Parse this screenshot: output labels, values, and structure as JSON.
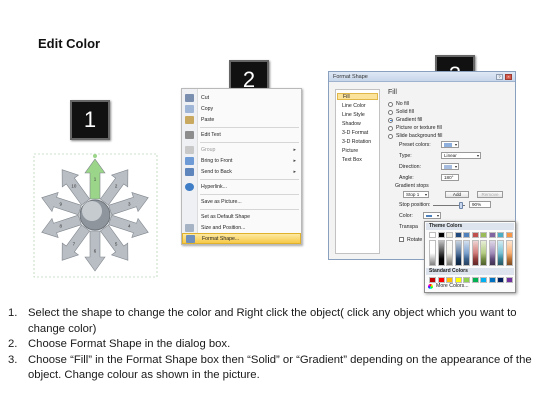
{
  "title": "Edit Color",
  "badges": [
    "1",
    "2",
    "3"
  ],
  "diagram": {
    "arrow_labels": [
      "1",
      "2",
      "3",
      "4",
      "5",
      "6",
      "7",
      "8",
      "9",
      "10"
    ],
    "hub_color": "#9aa0a6",
    "arrow_color": "#b9bec4",
    "selected_arrow_color": "#9bd58a"
  },
  "context_menu": {
    "items": [
      {
        "label": "Cut",
        "icon": "scissors-icon",
        "disabled": false
      },
      {
        "label": "Copy",
        "icon": "copy-icon",
        "disabled": false
      },
      {
        "label": "Paste",
        "icon": "paste-icon",
        "disabled": false
      },
      {
        "label": "Edit Text",
        "icon": "edit-text-icon",
        "disabled": false
      },
      {
        "label": "Group",
        "icon": "group-icon",
        "disabled": true,
        "submenu": true
      },
      {
        "label": "Bring to Front",
        "icon": "bring-front-icon",
        "disabled": false,
        "submenu": true
      },
      {
        "label": "Send to Back",
        "icon": "send-back-icon",
        "disabled": false,
        "submenu": true
      },
      {
        "label": "Hyperlink...",
        "icon": "hyperlink-icon",
        "disabled": false
      },
      {
        "label": "Save as Picture...",
        "icon": "",
        "disabled": false
      },
      {
        "label": "Set as Default Shape",
        "icon": "",
        "disabled": false
      },
      {
        "label": "Size and Position...",
        "icon": "size-icon",
        "disabled": false
      },
      {
        "label": "Format Shape...",
        "icon": "format-shape-icon",
        "disabled": false,
        "highlight": true
      }
    ]
  },
  "dialog": {
    "title": "Format Shape",
    "nav": [
      "Fill",
      "Line Color",
      "Line Style",
      "Shadow",
      "3-D Format",
      "3-D Rotation",
      "Picture",
      "Text Box"
    ],
    "heading": "Fill",
    "radios": [
      "No fill",
      "Solid fill",
      "Gradient fill",
      "Picture or texture fill",
      "Slide background fill"
    ],
    "selected_radio": "Gradient fill",
    "preset_colors_label": "Preset colors:",
    "type_label": "Type:",
    "type_value": "Linear",
    "direction_label": "Direction:",
    "angle_label": "Angle:",
    "angle_value": "180°",
    "gradient_stops_label": "Gradient stops",
    "stop_value": "Stop 1",
    "add_label": "Add",
    "remove_label": "Remove",
    "stop_position_label": "Stop position:",
    "stop_position_value": "90%",
    "color_label": "Color:",
    "transparency_label": "Transpa",
    "rotate_label": "Rotate"
  },
  "popup": {
    "theme_colors_label": "Theme Colors",
    "standard_colors_label": "Standard Colors",
    "more_colors_label": "More Colors...",
    "theme_top": [
      "#ffffff",
      "#000000",
      "#eeece1",
      "#1f497d",
      "#4f81bd",
      "#c0504d",
      "#9bbb59",
      "#8064a2",
      "#4bacc6",
      "#f79646"
    ],
    "standard": [
      "#c00000",
      "#ff0000",
      "#ffc000",
      "#ffff00",
      "#92d050",
      "#00b050",
      "#00b0f0",
      "#0070c0",
      "#002060",
      "#7030a0"
    ]
  },
  "instructions": [
    {
      "num": "1.",
      "text": "Select the shape to change the color and Right click the object( click any object which you want to change color)"
    },
    {
      "num": "2.",
      "text": "Choose Format Shape in the dialog box."
    },
    {
      "num": "3.",
      "text": "Choose “Fill” in the Format Shape box then “Solid” or “Gradient” depending on the appearance of the object. Change colour as shown in the picture."
    }
  ]
}
